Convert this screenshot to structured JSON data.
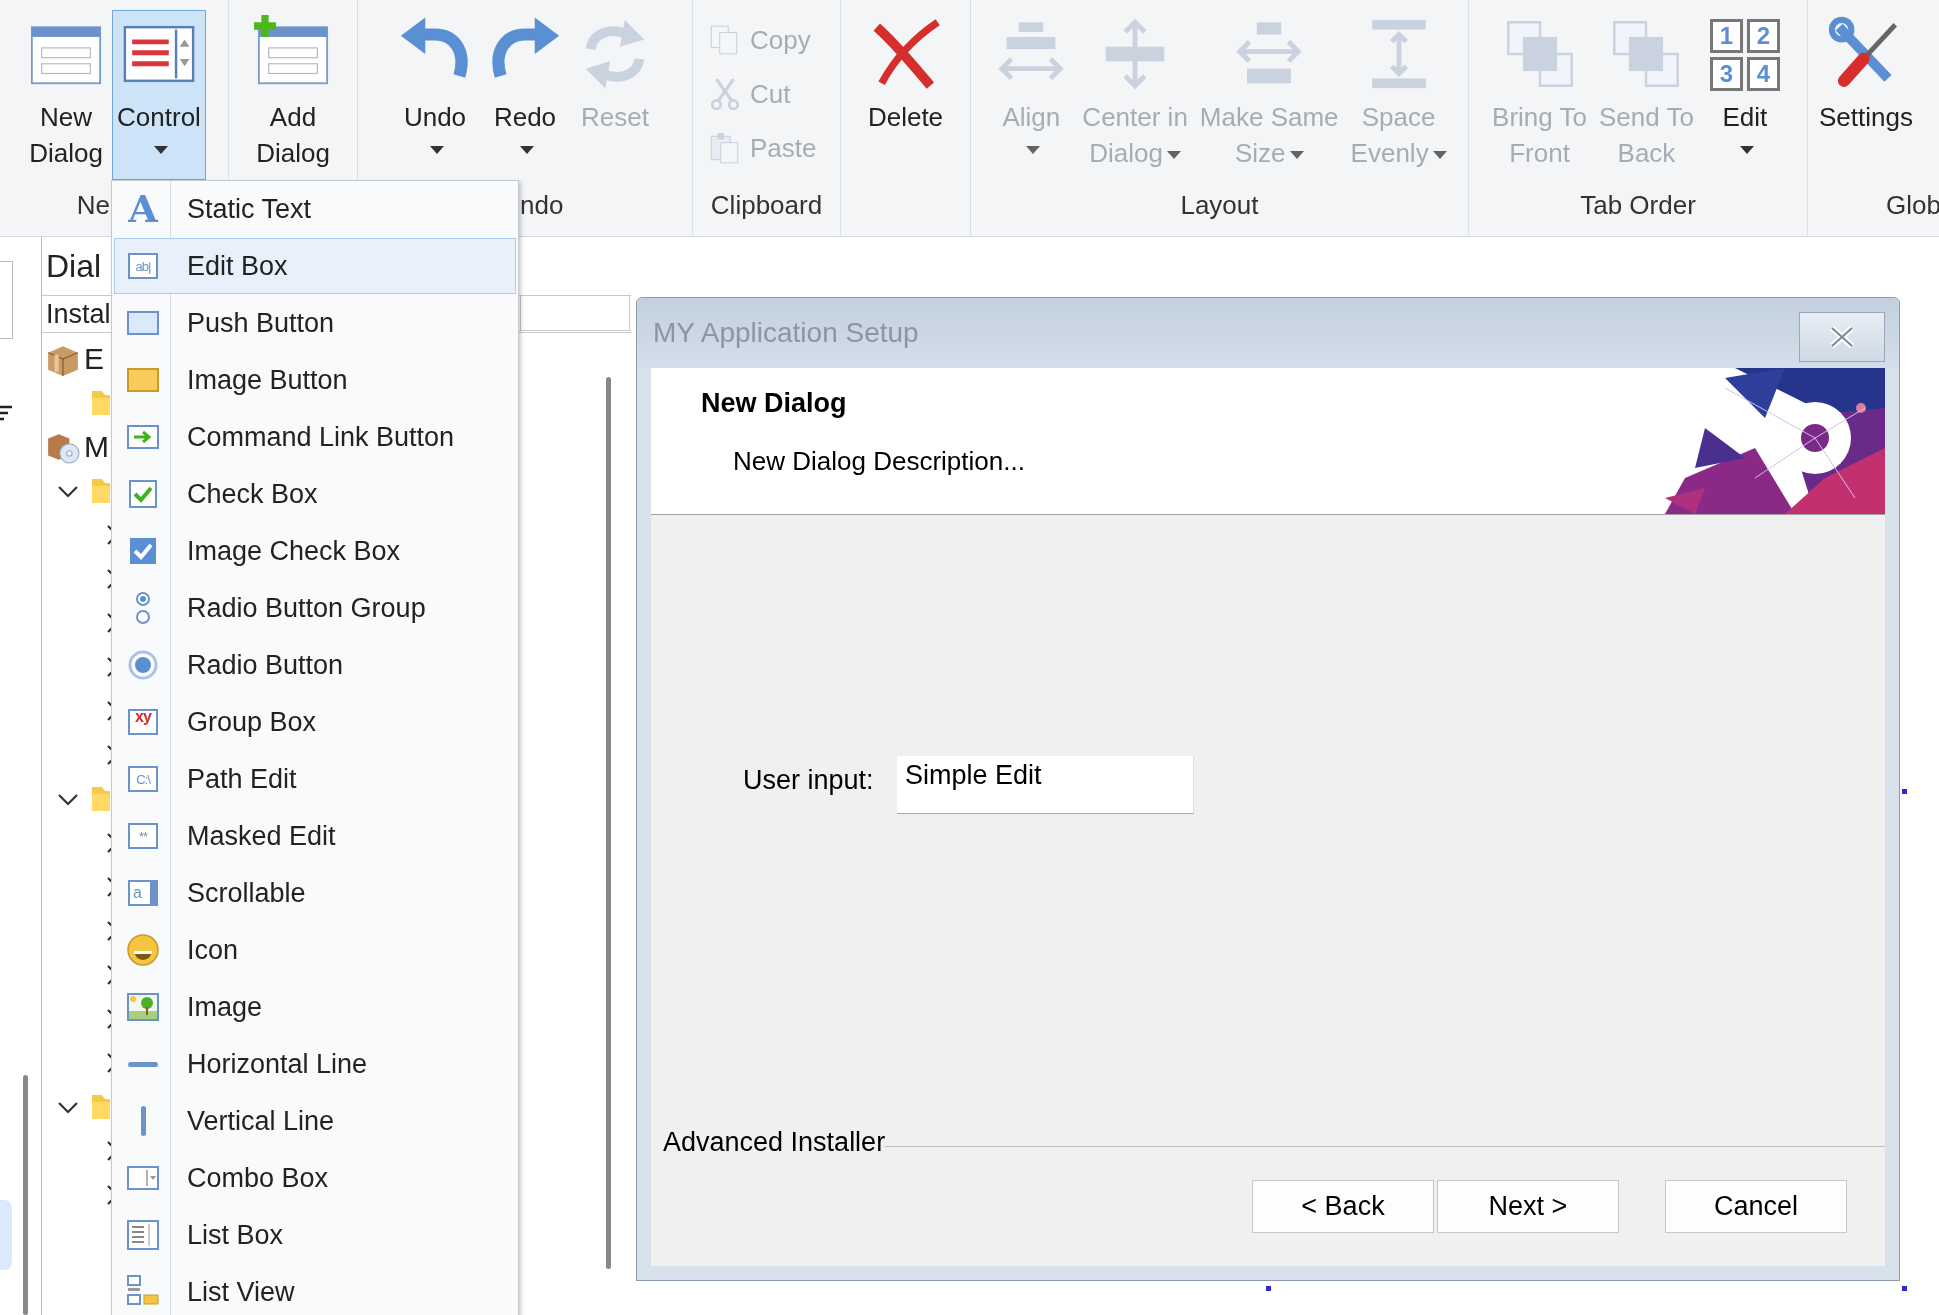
{
  "ribbon": {
    "groups": [
      {
        "label": "Ne",
        "buttons": [
          {
            "kind": "large",
            "lines": [
              "New",
              "Dialog"
            ],
            "dropdown": false,
            "pressed": false,
            "disabled": false
          },
          {
            "kind": "large",
            "lines": [
              "Control"
            ],
            "dropdown": true,
            "pressed": true,
            "disabled": false
          }
        ]
      },
      {
        "buttons": [
          {
            "kind": "large",
            "lines": [
              "Add",
              "Dialog"
            ],
            "dropdown": false,
            "pressed": false,
            "disabled": false
          }
        ]
      },
      {
        "label": "ndo",
        "buttons": [
          {
            "kind": "large",
            "lines": [
              "Undo"
            ],
            "dropdown": true,
            "pressed": false,
            "disabled": false
          },
          {
            "kind": "large",
            "lines": [
              "Redo"
            ],
            "dropdown": true,
            "pressed": false,
            "disabled": false
          },
          {
            "kind": "large",
            "lines": [
              "Reset"
            ],
            "dropdown": false,
            "pressed": false,
            "disabled": true
          }
        ]
      },
      {
        "label": "Clipboard",
        "buttons": [
          {
            "kind": "small",
            "lines": [
              "Copy"
            ],
            "disabled": true
          },
          {
            "kind": "small",
            "lines": [
              "Cut"
            ],
            "disabled": true
          },
          {
            "kind": "small",
            "lines": [
              "Paste"
            ],
            "disabled": true
          }
        ]
      },
      {
        "buttons": [
          {
            "kind": "large",
            "lines": [
              "Delete"
            ],
            "dropdown": false,
            "pressed": false,
            "disabled": false
          }
        ]
      },
      {
        "label": "Layout",
        "buttons": [
          {
            "kind": "large",
            "lines": [
              "Align"
            ],
            "dropdown": true,
            "pressed": false,
            "disabled": true
          },
          {
            "kind": "large",
            "lines": [
              "Center in",
              "Dialog"
            ],
            "dropdown": true,
            "pressed": false,
            "disabled": true
          },
          {
            "kind": "large",
            "lines": [
              "Make Same",
              "Size"
            ],
            "dropdown": true,
            "pressed": false,
            "disabled": true
          },
          {
            "kind": "large",
            "lines": [
              "Space",
              "Evenly"
            ],
            "dropdown": true,
            "pressed": false,
            "disabled": true
          }
        ]
      },
      {
        "label": "Tab Order",
        "buttons": [
          {
            "kind": "large",
            "lines": [
              "Bring To",
              "Front"
            ],
            "dropdown": false,
            "pressed": false,
            "disabled": true
          },
          {
            "kind": "large",
            "lines": [
              "Send To",
              "Back"
            ],
            "dropdown": false,
            "pressed": false,
            "disabled": true
          },
          {
            "kind": "large",
            "lines": [
              "Edit"
            ],
            "dropdown": true,
            "pressed": false,
            "disabled": false,
            "icon_digits": [
              "1",
              "2",
              "3",
              "4"
            ]
          }
        ]
      },
      {
        "label": "Glob",
        "buttons": [
          {
            "kind": "large",
            "lines": [
              "Settings"
            ],
            "dropdown": false,
            "pressed": false,
            "disabled": false
          }
        ]
      }
    ]
  },
  "tree": {
    "title": "Dial",
    "column_header": "Instal",
    "items": [
      {
        "kind": "product",
        "label": "E",
        "children": [
          {
            "kind": "folder"
          }
        ]
      },
      {
        "kind": "media",
        "label": "M",
        "children": [
          {
            "kind": "folder",
            "expanded": true,
            "children": [
              {
                "expanded": false
              },
              {
                "expanded": false
              },
              {
                "expanded": false
              },
              {
                "expanded": false
              },
              {
                "expanded": false
              },
              {
                "expanded": false
              }
            ]
          },
          {
            "kind": "folder",
            "expanded": true,
            "children": [
              {
                "expanded": false
              },
              {
                "expanded": false
              },
              {
                "expanded": false
              },
              {
                "expanded": false
              },
              {
                "expanded": false
              },
              {
                "expanded": false
              }
            ]
          },
          {
            "kind": "folder",
            "expanded": true,
            "children": [
              {
                "expanded": false
              },
              {
                "expanded": false
              }
            ]
          }
        ]
      }
    ]
  },
  "control_menu": {
    "items": [
      {
        "label": "Static Text",
        "selected": false,
        "icon_text": "A"
      },
      {
        "label": "Edit Box",
        "selected": true,
        "icon_text": "ab|"
      },
      {
        "label": "Push Button",
        "selected": false
      },
      {
        "label": "Image Button",
        "selected": false
      },
      {
        "label": "Command Link Button",
        "selected": false
      },
      {
        "label": "Check Box",
        "selected": false
      },
      {
        "label": "Image Check Box",
        "selected": false
      },
      {
        "label": "Radio Button Group",
        "selected": false
      },
      {
        "label": "Radio Button",
        "selected": false
      },
      {
        "label": "Group Box",
        "selected": false,
        "icon_text": "xy"
      },
      {
        "label": "Path Edit",
        "selected": false,
        "icon_text": "C:\\"
      },
      {
        "label": "Masked Edit",
        "selected": false,
        "icon_text": "**"
      },
      {
        "label": "Scrollable",
        "selected": false,
        "icon_text": "a"
      },
      {
        "label": "Icon",
        "selected": false
      },
      {
        "label": "Image",
        "selected": false
      },
      {
        "label": "Horizontal Line",
        "selected": false
      },
      {
        "label": "Vertical Line",
        "selected": false
      },
      {
        "label": "Combo Box",
        "selected": false
      },
      {
        "label": "List Box",
        "selected": false
      },
      {
        "label": "List View",
        "selected": false
      }
    ]
  },
  "dialog": {
    "title": "MY Application Setup",
    "heading": "New Dialog",
    "description": "New Dialog Description...",
    "controls": [
      {
        "kind": "label",
        "text": "User input:"
      },
      {
        "kind": "edit",
        "value": "Simple Edit"
      },
      {
        "kind": "separator_label",
        "text": "Advanced Installer"
      },
      {
        "kind": "button",
        "text": "< Back"
      },
      {
        "kind": "button",
        "text": "Next >"
      },
      {
        "kind": "button",
        "text": "Cancel"
      }
    ]
  }
}
